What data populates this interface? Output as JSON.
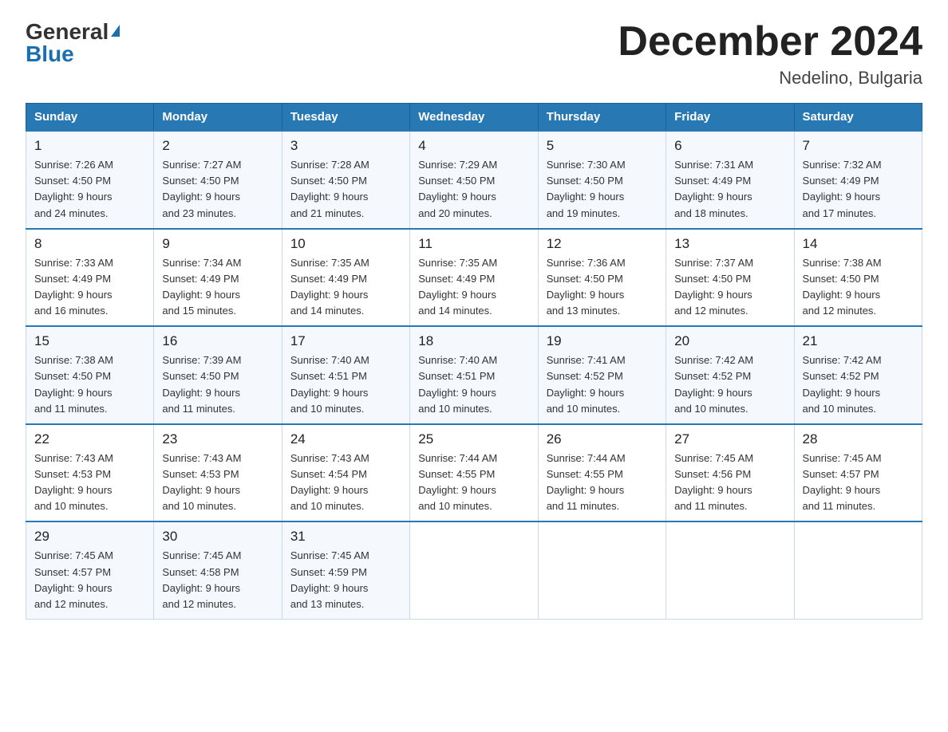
{
  "header": {
    "logo_general": "General",
    "logo_blue": "Blue",
    "month_title": "December 2024",
    "location": "Nedelino, Bulgaria"
  },
  "days_of_week": [
    "Sunday",
    "Monday",
    "Tuesday",
    "Wednesday",
    "Thursday",
    "Friday",
    "Saturday"
  ],
  "weeks": [
    [
      {
        "day": "1",
        "sunrise": "7:26 AM",
        "sunset": "4:50 PM",
        "daylight": "9 hours and 24 minutes."
      },
      {
        "day": "2",
        "sunrise": "7:27 AM",
        "sunset": "4:50 PM",
        "daylight": "9 hours and 23 minutes."
      },
      {
        "day": "3",
        "sunrise": "7:28 AM",
        "sunset": "4:50 PM",
        "daylight": "9 hours and 21 minutes."
      },
      {
        "day": "4",
        "sunrise": "7:29 AM",
        "sunset": "4:50 PM",
        "daylight": "9 hours and 20 minutes."
      },
      {
        "day": "5",
        "sunrise": "7:30 AM",
        "sunset": "4:50 PM",
        "daylight": "9 hours and 19 minutes."
      },
      {
        "day": "6",
        "sunrise": "7:31 AM",
        "sunset": "4:49 PM",
        "daylight": "9 hours and 18 minutes."
      },
      {
        "day": "7",
        "sunrise": "7:32 AM",
        "sunset": "4:49 PM",
        "daylight": "9 hours and 17 minutes."
      }
    ],
    [
      {
        "day": "8",
        "sunrise": "7:33 AM",
        "sunset": "4:49 PM",
        "daylight": "9 hours and 16 minutes."
      },
      {
        "day": "9",
        "sunrise": "7:34 AM",
        "sunset": "4:49 PM",
        "daylight": "9 hours and 15 minutes."
      },
      {
        "day": "10",
        "sunrise": "7:35 AM",
        "sunset": "4:49 PM",
        "daylight": "9 hours and 14 minutes."
      },
      {
        "day": "11",
        "sunrise": "7:35 AM",
        "sunset": "4:49 PM",
        "daylight": "9 hours and 14 minutes."
      },
      {
        "day": "12",
        "sunrise": "7:36 AM",
        "sunset": "4:50 PM",
        "daylight": "9 hours and 13 minutes."
      },
      {
        "day": "13",
        "sunrise": "7:37 AM",
        "sunset": "4:50 PM",
        "daylight": "9 hours and 12 minutes."
      },
      {
        "day": "14",
        "sunrise": "7:38 AM",
        "sunset": "4:50 PM",
        "daylight": "9 hours and 12 minutes."
      }
    ],
    [
      {
        "day": "15",
        "sunrise": "7:38 AM",
        "sunset": "4:50 PM",
        "daylight": "9 hours and 11 minutes."
      },
      {
        "day": "16",
        "sunrise": "7:39 AM",
        "sunset": "4:50 PM",
        "daylight": "9 hours and 11 minutes."
      },
      {
        "day": "17",
        "sunrise": "7:40 AM",
        "sunset": "4:51 PM",
        "daylight": "9 hours and 10 minutes."
      },
      {
        "day": "18",
        "sunrise": "7:40 AM",
        "sunset": "4:51 PM",
        "daylight": "9 hours and 10 minutes."
      },
      {
        "day": "19",
        "sunrise": "7:41 AM",
        "sunset": "4:52 PM",
        "daylight": "9 hours and 10 minutes."
      },
      {
        "day": "20",
        "sunrise": "7:42 AM",
        "sunset": "4:52 PM",
        "daylight": "9 hours and 10 minutes."
      },
      {
        "day": "21",
        "sunrise": "7:42 AM",
        "sunset": "4:52 PM",
        "daylight": "9 hours and 10 minutes."
      }
    ],
    [
      {
        "day": "22",
        "sunrise": "7:43 AM",
        "sunset": "4:53 PM",
        "daylight": "9 hours and 10 minutes."
      },
      {
        "day": "23",
        "sunrise": "7:43 AM",
        "sunset": "4:53 PM",
        "daylight": "9 hours and 10 minutes."
      },
      {
        "day": "24",
        "sunrise": "7:43 AM",
        "sunset": "4:54 PM",
        "daylight": "9 hours and 10 minutes."
      },
      {
        "day": "25",
        "sunrise": "7:44 AM",
        "sunset": "4:55 PM",
        "daylight": "9 hours and 10 minutes."
      },
      {
        "day": "26",
        "sunrise": "7:44 AM",
        "sunset": "4:55 PM",
        "daylight": "9 hours and 11 minutes."
      },
      {
        "day": "27",
        "sunrise": "7:45 AM",
        "sunset": "4:56 PM",
        "daylight": "9 hours and 11 minutes."
      },
      {
        "day": "28",
        "sunrise": "7:45 AM",
        "sunset": "4:57 PM",
        "daylight": "9 hours and 11 minutes."
      }
    ],
    [
      {
        "day": "29",
        "sunrise": "7:45 AM",
        "sunset": "4:57 PM",
        "daylight": "9 hours and 12 minutes."
      },
      {
        "day": "30",
        "sunrise": "7:45 AM",
        "sunset": "4:58 PM",
        "daylight": "9 hours and 12 minutes."
      },
      {
        "day": "31",
        "sunrise": "7:45 AM",
        "sunset": "4:59 PM",
        "daylight": "9 hours and 13 minutes."
      },
      null,
      null,
      null,
      null
    ]
  ],
  "labels": {
    "sunrise": "Sunrise:",
    "sunset": "Sunset:",
    "daylight": "Daylight:"
  }
}
